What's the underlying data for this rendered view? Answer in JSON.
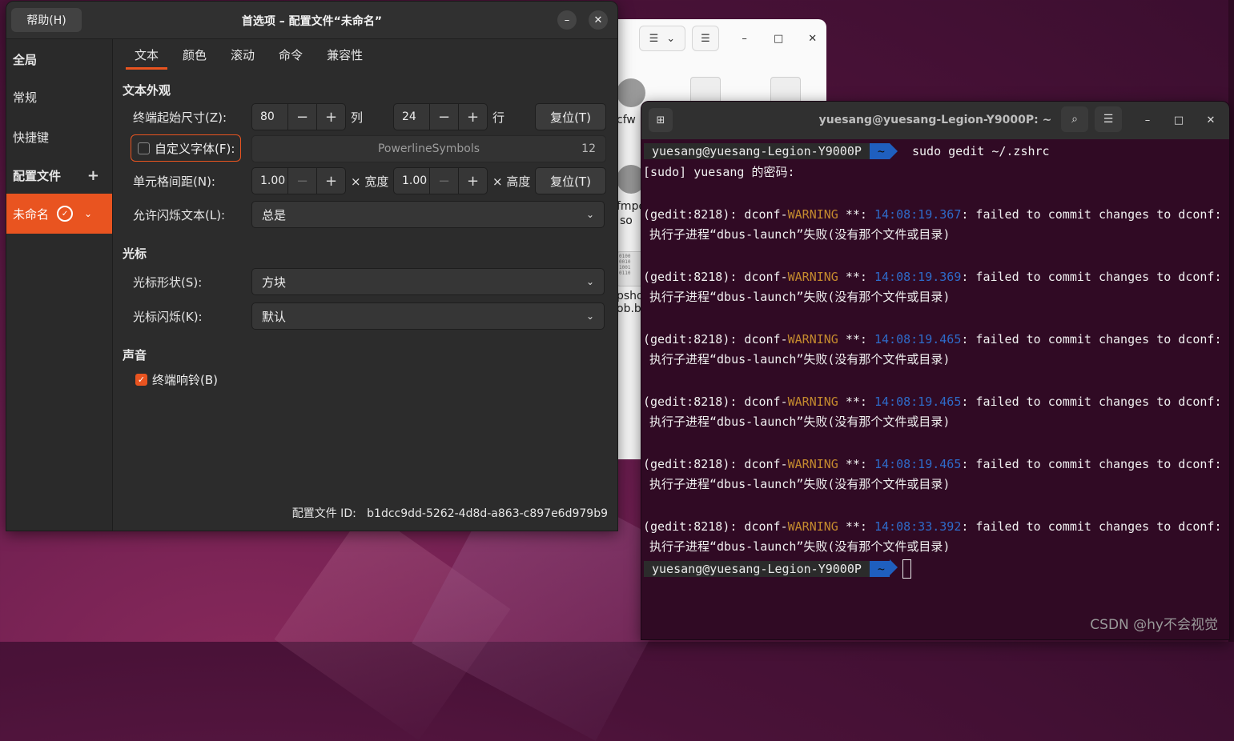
{
  "prefs": {
    "help_button": "帮助(H)",
    "title": "首选项 – 配置文件“未命名”",
    "minimize_symbol": "–",
    "close_symbol": "✕",
    "sidebar": {
      "global": "全局",
      "general": "常规",
      "shortcuts": "快捷键",
      "profiles_header": "配置文件",
      "add_symbol": "+",
      "profile_name": "未命名"
    },
    "tabs": [
      "文本",
      "颜色",
      "滚动",
      "命令",
      "兼容性"
    ],
    "text_appearance": {
      "header": "文本外观",
      "initial_size_label": "终端起始尺寸(Z):",
      "columns_value": "80",
      "columns_unit": "列",
      "rows_value": "24",
      "rows_unit": "行",
      "reset_label": "复位(T)",
      "custom_font_label": "自定义字体(F):",
      "font_name": "PowerlineSymbols",
      "font_size": "12",
      "cell_spacing_label": "单元格间距(N):",
      "width_value": "1.00",
      "width_unit": "× 宽度",
      "height_value": "1.00",
      "height_unit": "× 高度",
      "reset2_label": "复位(T)",
      "blink_label": "允许闪烁文本(L):",
      "blink_value": "总是"
    },
    "cursor": {
      "header": "光标",
      "shape_label": "光标形状(S):",
      "shape_value": "方块",
      "blink_label": "光标闪烁(K):",
      "blink_value": "默认"
    },
    "sound": {
      "header": "声音",
      "bell_label": "终端响铃(B)"
    },
    "profile_id_label": "配置文件 ID:",
    "profile_id_value": "b1dcc9dd-5262-4d8d-a863-c897e6d979b9"
  },
  "files_window": {
    "labels": [
      "cfw",
      "fmpe",
      "so",
      "psho",
      "ob.bi"
    ]
  },
  "terminal": {
    "title": "yuesang@yuesang-Legion-Y9000P: ~",
    "prompt_user": "yuesang@yuesang-Legion-Y9000P",
    "prompt_dir": "~",
    "command": "sudo gedit ~/.zshrc",
    "sudo_prompt": "[sudo] yuesang 的密码:",
    "warn_prefix": "(gedit:8218): dconf-",
    "warn_word": "WARNING",
    "warn_mid": " **: ",
    "warn_suffix": ": failed to commit changes to dconf:",
    "warn_detail": "执行子进程“dbus-launch”失败(没有那个文件或目录)",
    "timestamps": [
      "14:08:19.367",
      "14:08:19.369",
      "14:08:19.465",
      "14:08:19.465",
      "14:08:19.465",
      "14:08:33.392"
    ]
  },
  "watermark": "CSDN @hy不会视觉"
}
